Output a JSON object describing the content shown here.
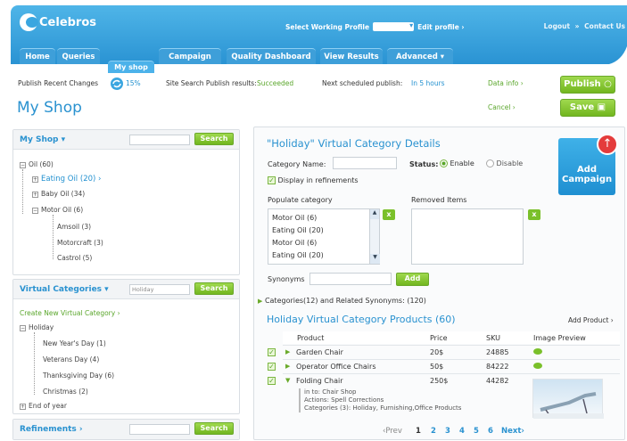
{
  "header": {
    "logo": "Celebros",
    "profile_label": "Select Working Profile",
    "edit_profile": "Edit profile ›",
    "logout": "Logout",
    "separator": "»",
    "contact": "Contact Us"
  },
  "tabs": [
    {
      "label": "Home"
    },
    {
      "label": "Queries"
    },
    {
      "label": "My shop"
    },
    {
      "label": "Campaign"
    },
    {
      "label": "Quality Dashboard"
    },
    {
      "label": "View Results"
    },
    {
      "label": "Advanced ▾"
    }
  ],
  "status": {
    "publish_recent": "Publish Recent Changes",
    "percent": "15%",
    "site_search_label": "Site Search Publish results:",
    "site_search_value": "Succeeded",
    "next_label": "Next scheduled publish:",
    "next_value": "In 5 hours",
    "data_info": "Data info ›",
    "cancel": "Cancel ›",
    "progress": 0.15
  },
  "page_title": "My Shop",
  "buttons": {
    "publish": "Publish",
    "save": "Save"
  },
  "myshop": {
    "title": "My Shop ▾",
    "search": "Search",
    "tree": [
      {
        "label": "Oil (60)",
        "sign": "−"
      },
      {
        "label": "Eating Oil (20) ›",
        "sign": "+"
      },
      {
        "label": "Baby Oil (34)",
        "sign": "+"
      },
      {
        "label": "Motor Oil (6)",
        "sign": "−"
      },
      {
        "label": "Amsoil (3)"
      },
      {
        "label": "Motorcraft (3)"
      },
      {
        "label": "Castrol (5)"
      }
    ]
  },
  "virtual": {
    "title": "Virtual Categories ▾",
    "input_value": "Holiday",
    "search": "Search",
    "create": "Create New Virtual Category ›",
    "tree": [
      {
        "label": "Holiday",
        "sign": "−"
      },
      {
        "label": "New Year's Day (1)"
      },
      {
        "label": "Veterans Day (4)"
      },
      {
        "label": "Thanksgiving Day (6)"
      },
      {
        "label": "Christmas (2)"
      },
      {
        "label": "End of year",
        "sign": "+"
      }
    ]
  },
  "refinements": {
    "title": "Refinements ›",
    "search": "Search"
  },
  "details": {
    "title": "\"Holiday\" Virtual Category Details",
    "category_name": "Category Name:",
    "status_label": "Status:",
    "enable": "Enable",
    "disable": "Disable",
    "display_refinements": "Display in refinements",
    "populate": "Populate category",
    "removed": "Removed Items",
    "populate_items": [
      "Motor Oil (6)",
      "Eating Oil (20)",
      "Motor Oil (6)",
      "Eating Oil (20)"
    ],
    "synonyms": "Synonyms",
    "add": "Add",
    "categories_line": "Categories(12) and Related Synonyms: (120)",
    "add_campaign": "Add Campaign"
  },
  "products": {
    "title": "Holiday  Virtual Category  Products (60)",
    "add_product": "Add Product ›",
    "headers": [
      "Product",
      "Price",
      "SKU",
      "Image Preview"
    ],
    "rows": [
      {
        "name": "Garden Chair",
        "price": "20$",
        "sku": "24885"
      },
      {
        "name": "Operator Office Chairs",
        "price": "50$",
        "sku": "84222"
      },
      {
        "name": "Folding Chair",
        "price": "250$",
        "sku": "44282"
      }
    ],
    "expanded": {
      "info": "in to: Chair Shop",
      "actions": "Actions: Spell Corrections",
      "categories": "Categories (3): Holiday, Furnishing,Office Products"
    }
  },
  "pagination": {
    "prev": "‹Prev",
    "pages": [
      "1",
      "2",
      "3",
      "4",
      "5",
      "6"
    ],
    "next": "Next›"
  }
}
